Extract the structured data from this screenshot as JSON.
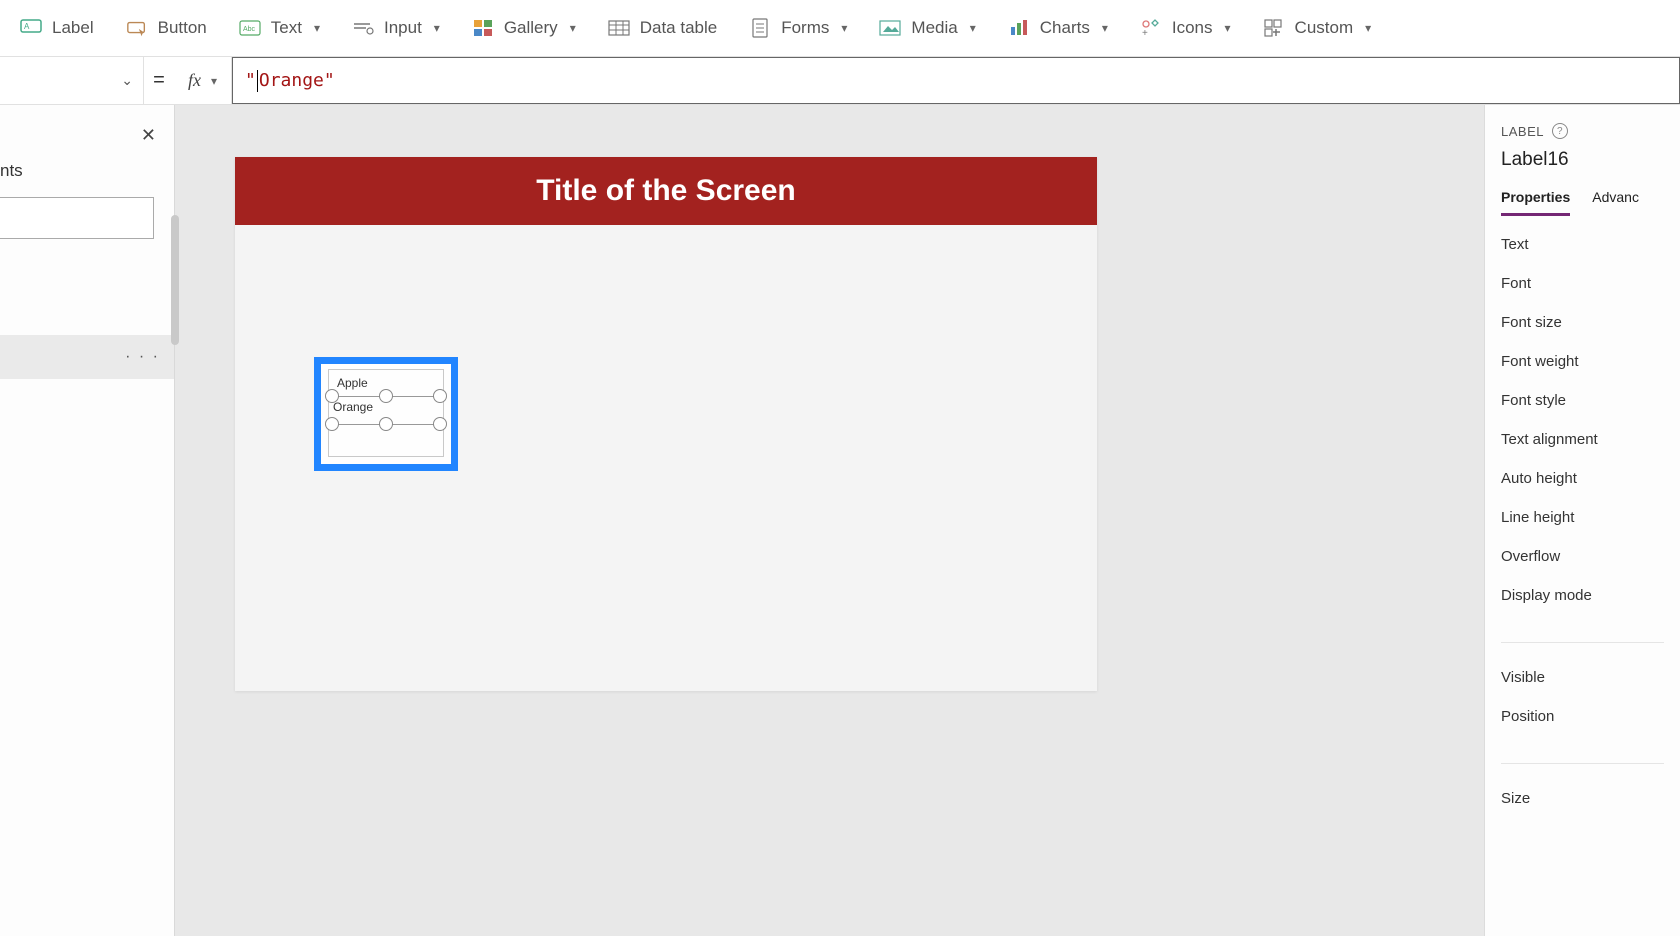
{
  "ribbon": {
    "label": "Label",
    "button": "Button",
    "text": "Text",
    "input": "Input",
    "gallery": "Gallery",
    "dataTable": "Data table",
    "forms": "Forms",
    "media": "Media",
    "charts": "Charts",
    "icons": "Icons",
    "custom": "Custom"
  },
  "formulaBar": {
    "equals": "=",
    "fx": "fx",
    "value": "\"Orange\""
  },
  "tree": {
    "headerSuffix": "nts",
    "more": "· · ·"
  },
  "canvas": {
    "title": "Title of the Screen",
    "item1": "Apple",
    "item2": "Orange"
  },
  "props": {
    "type": "LABEL",
    "control": "Label16",
    "tabs": {
      "properties": "Properties",
      "advanced": "Advanc"
    },
    "fields": {
      "text": "Text",
      "font": "Font",
      "fontSize": "Font size",
      "fontWeight": "Font weight",
      "fontStyle": "Font style",
      "textAlign": "Text alignment",
      "autoHeight": "Auto height",
      "lineHeight": "Line height",
      "overflow": "Overflow",
      "displayMode": "Display mode",
      "visible": "Visible",
      "position": "Position",
      "size": "Size"
    }
  }
}
